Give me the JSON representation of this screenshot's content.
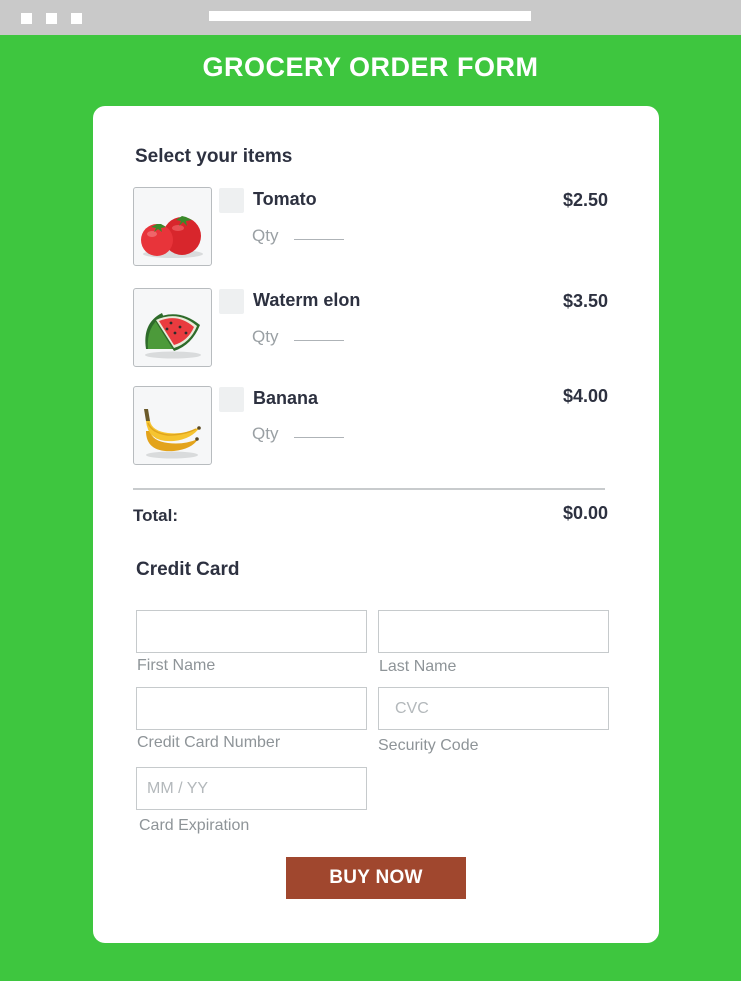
{
  "browser": {
    "controls": [
      "close",
      "minimize",
      "maximize"
    ]
  },
  "form": {
    "title": "GROCERY ORDER FORM"
  },
  "items_section": {
    "heading": "Select your items",
    "qty_label": "Qty",
    "items": [
      {
        "name": "Tomato",
        "price": "$2.50",
        "icon": "tomato-icon",
        "checked": false
      },
      {
        "name": "Waterm elon",
        "price": "$3.50",
        "icon": "watermelon-icon",
        "checked": false
      },
      {
        "name": "Banana",
        "price": "$4.00",
        "icon": "banana-icon",
        "checked": false
      }
    ],
    "total_label": "Total:",
    "total_value": "$0.00"
  },
  "payment": {
    "heading": "Credit Card",
    "first_name": {
      "label": "First Name",
      "value": "",
      "placeholder": ""
    },
    "last_name": {
      "label": "Last Name",
      "value": "",
      "placeholder": ""
    },
    "card_number": {
      "label": "Credit Card Number",
      "value": "",
      "placeholder": ""
    },
    "security_code": {
      "label": "Security Code",
      "value": "",
      "placeholder": "CVC"
    },
    "expiration": {
      "label": "Card Expiration",
      "value": "",
      "placeholder": "MM / YY"
    }
  },
  "buy_button": {
    "label": "BUY NOW"
  },
  "colors": {
    "background": "#3ec63f",
    "card": "#ffffff",
    "button": "#a0472e",
    "text": "#2d3140",
    "muted": "#9aa0a4"
  }
}
